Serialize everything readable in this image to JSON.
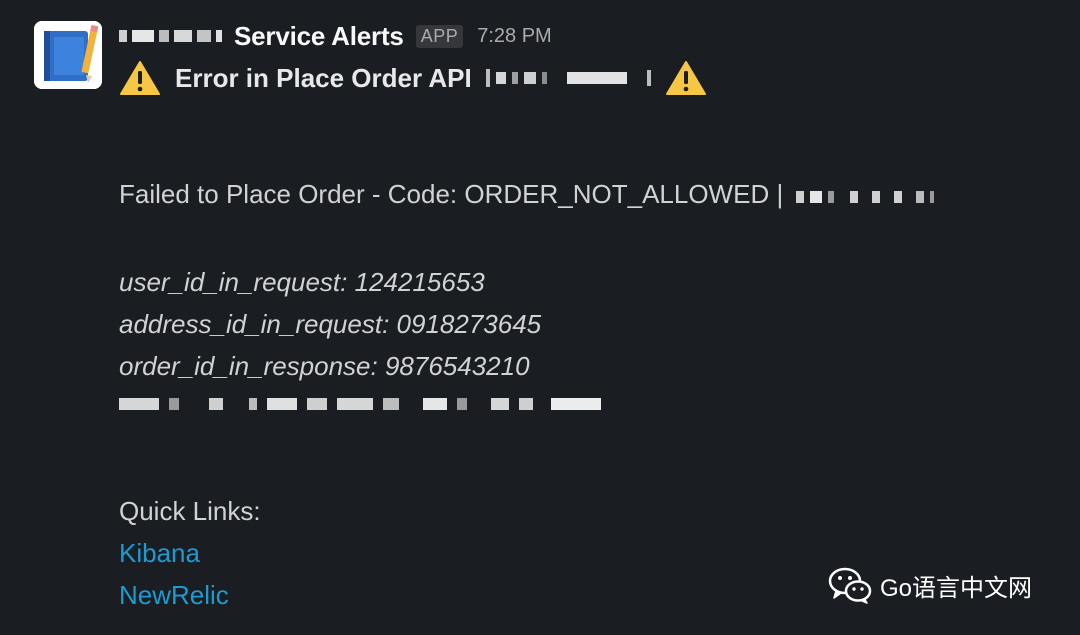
{
  "message": {
    "sender": "Service Alerts",
    "badge": "APP",
    "time": "7:28 PM",
    "avatar_icon": "notebook-pencil-icon",
    "title": "Error in Place Order API",
    "warning_icon": "warning-triangle-icon",
    "failure_line": "Failed to Place Order - Code: ORDER_NOT_ALLOWED |",
    "fields": [
      "user_id_in_request: 124215653",
      "address_id_in_request: 0918273645",
      "order_id_in_response: 9876543210"
    ],
    "quick_links_label": "Quick Links:",
    "links": [
      "Kibana",
      "NewRelic"
    ]
  },
  "watermark": {
    "text": "Go语言中文网",
    "icon": "wechat-icon"
  },
  "colors": {
    "background": "#1a1d21",
    "link": "#1d9bd1",
    "text": "#d1d2d3",
    "warning": "#f6c744"
  }
}
